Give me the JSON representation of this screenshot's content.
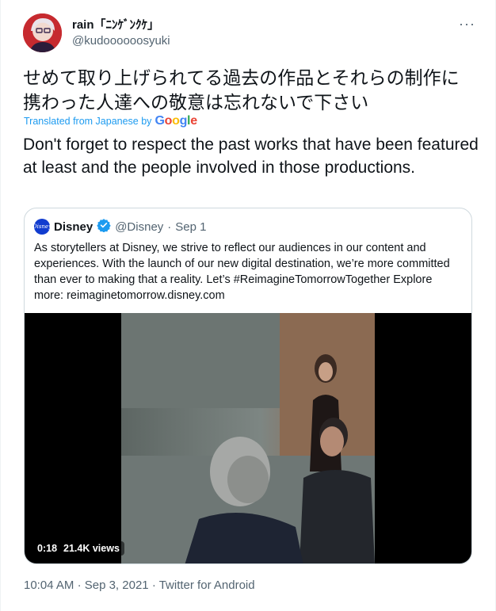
{
  "author": {
    "name": "rain「ﾆﾝｹﾞﾝｸｹ」",
    "handle": "@kudoooooosyuki"
  },
  "tweet": {
    "original_text": "せめて取り上げられてる過去の作品とそれらの制作に携わった人達への敬意は忘れないで下さい",
    "translated_label": "Translated from Japanese by",
    "translator": "Google",
    "translated_text": "Don't forget to respect the past works that have been featured at least and the people involved in those productions."
  },
  "quoted": {
    "avatar_text": "Disney",
    "name": "Disney",
    "handle": "@Disney",
    "separator": "·",
    "date": "Sep 1",
    "text": "As storytellers at Disney, we strive to reflect our audiences in our content and experiences. With the launch of our new digital destination, we’re more committed than ever to making that a reality. Let’s #ReimagineTomorrowTogether Explore more: reimaginetomorrow.disney.com",
    "video": {
      "time": "0:18",
      "views": "21.4K views"
    }
  },
  "meta": {
    "time": "10:04 AM",
    "separator": "·",
    "date": "Sep 3, 2021",
    "source": "Twitter for Android"
  },
  "icons": {
    "more": "more-dots-icon",
    "verified": "verified-badge-icon"
  },
  "colors": {
    "accent": "#1d9bf0",
    "secondary_text": "#536471",
    "border": "#cfd9de"
  }
}
